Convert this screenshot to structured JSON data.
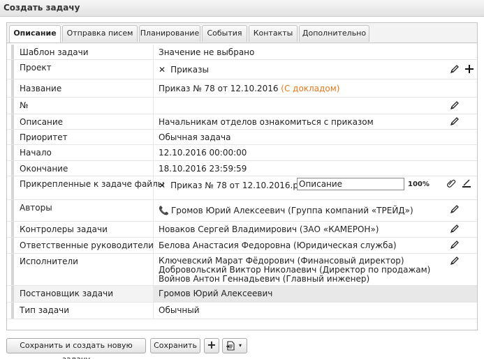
{
  "header": {
    "title": "Создать задачу"
  },
  "tabs": [
    {
      "label": "Описание"
    },
    {
      "label": "Отправка писем"
    },
    {
      "label": "Планирование"
    },
    {
      "label": "События"
    },
    {
      "label": "Контакты"
    },
    {
      "label": "Дополнительно"
    }
  ],
  "fields": {
    "template": {
      "label": "Шаблон задачи",
      "value": "Значение не выбрано"
    },
    "project": {
      "label": "Проект",
      "value": "Приказы"
    },
    "name": {
      "label": "Название",
      "value": "Приказ № 78 от 12.10.2016",
      "suffix": "(С докладом)"
    },
    "number": {
      "label": "№",
      "value": ""
    },
    "description": {
      "label": "Описание",
      "value": "Начальникам отделов ознакомиться с приказом"
    },
    "priority": {
      "label": "Приоритет",
      "value": "Обычная задача"
    },
    "start": {
      "label": "Начало",
      "value": "12.10.2016 00:00:00"
    },
    "end": {
      "label": "Окончание",
      "value": "18.10.2016 23:59:59"
    },
    "files": {
      "label": "Прикрепленные к задаче файлы",
      "file_name": "Приказ № 78 от 12.10.2016.pdf",
      "file_description": "Описание",
      "progress": "100%"
    },
    "authors": {
      "label": "Авторы",
      "value": "Громов Юрий Алексеевич (Группа компаний «ТРЕЙД»)"
    },
    "controllers": {
      "label": "Контролеры задачи",
      "value": "Новаков Сергей Владимирович (ЗАО «КАМЕРОН»)"
    },
    "managers": {
      "label": "Ответственные руководители",
      "value": "Белова Анастасия Федоровна (Юридическая служба)"
    },
    "executors": {
      "label": "Исполнители",
      "values": [
        "Ключевский Марат Фёдорович (Финансовый директор)",
        "Добровольский Виктор Николаевич (Директор по продажам)",
        "Войнов Антон Геннадьевич (Главный инженер)"
      ]
    },
    "setter": {
      "label": "Постановщик задачи",
      "value": "Громов Юрий Алексеевич"
    },
    "type": {
      "label": "Тип задачи",
      "value": "Обычный"
    }
  },
  "buttons": {
    "save_and_new": "Сохранить и создать новую задачу",
    "save": "Сохранить"
  },
  "icons": {
    "edit": "pencil-icon",
    "add": "plus-icon",
    "attach": "paperclip-icon",
    "scan": "scanner-icon",
    "phone": "phone-icon",
    "remove": "x-icon",
    "doc_menu": "document-export-icon"
  }
}
